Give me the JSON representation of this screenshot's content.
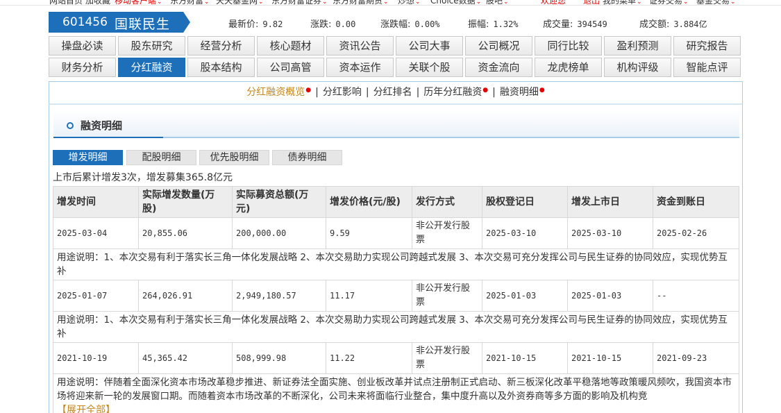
{
  "top_nav": [
    {
      "label": "网站首页",
      "red": false,
      "caret": false
    },
    {
      "label": "加收藏",
      "red": false,
      "caret": false
    },
    {
      "label": "移动客户端",
      "red": true,
      "caret": true
    },
    {
      "label": "东方财富",
      "red": false,
      "caret": true
    },
    {
      "label": "天天基金网",
      "red": false,
      "caret": true
    },
    {
      "label": "东方财富证券",
      "red": false,
      "caret": true
    },
    {
      "label": "东方财富期货",
      "red": false,
      "caret": true
    },
    {
      "label": "炒想",
      "red": false,
      "caret": true
    },
    {
      "label": "Choice数据",
      "red": false,
      "caret": true
    },
    {
      "label": "股吧",
      "red": false,
      "caret": true
    },
    {
      "label": "欢迎您",
      "red": true,
      "caret": false
    },
    {
      "label": "退出",
      "red": true,
      "caret": false
    },
    {
      "label": "我的菜单",
      "red": false,
      "caret": true
    },
    {
      "label": "证券交易",
      "red": false,
      "caret": true
    },
    {
      "label": "基金交易",
      "red": false,
      "caret": true
    }
  ],
  "stock": {
    "code": "601456",
    "name": "国联民生",
    "quotes": [
      {
        "label": "最新价:",
        "value": "9.82"
      },
      {
        "label": "涨跌:",
        "value": "0.00"
      },
      {
        "label": "涨跌幅:",
        "value": "0.00%"
      },
      {
        "label": "振幅:",
        "value": "1.32%"
      },
      {
        "label": "成交量:",
        "value": "394549"
      },
      {
        "label": "成交额:",
        "value": "3.884亿"
      }
    ]
  },
  "tabs": {
    "row1": [
      "操盘必读",
      "股东研究",
      "经营分析",
      "核心题材",
      "资讯公告",
      "公司大事",
      "公司概况",
      "同行比较",
      "盈利预测",
      "研究报告"
    ],
    "row2": [
      "财务分析",
      "分红融资",
      "股本结构",
      "公司高管",
      "资本运作",
      "关联个股",
      "资金流向",
      "龙虎榜单",
      "机构评级",
      "智能点评"
    ],
    "active": "分红融资"
  },
  "subnav": {
    "items": [
      {
        "label": "分红融资概览",
        "dot": true,
        "current": true
      },
      {
        "label": "分红影响",
        "dot": false,
        "current": false
      },
      {
        "label": "分红排名",
        "dot": false,
        "current": false
      },
      {
        "label": "历年分红融资",
        "dot": true,
        "current": false
      },
      {
        "label": "融资明细",
        "dot": true,
        "current": false
      }
    ],
    "dot_glyph": "●"
  },
  "section": {
    "title": "融资明细",
    "subtabs": [
      "增发明细",
      "配股明细",
      "优先股明细",
      "债券明细"
    ],
    "active_subtab": "增发明细",
    "summary": "上市后累计增发3次，增发募集365.8亿元",
    "expand_label": "【展开全部】"
  },
  "table": {
    "headers": [
      "增发时间",
      "实际增发数量(万股)",
      "实际募资总额(万元)",
      "增发价格(元/股)",
      "发行方式",
      "股权登记日",
      "增发上市日",
      "资金到账日"
    ],
    "rows": [
      {
        "cells": [
          "2025-03-04",
          "20,855.06",
          "200,000.00",
          "9.59",
          "非公开发行股票",
          "2025-03-10",
          "2025-03-10",
          "2025-02-26"
        ],
        "usage": "用途说明：1、本次交易有利于落实长三角一体化发展战略 2、本次交易助力实现公司跨越式发展 3、本次交易可充分发挥公司与民生证券的协同效应，实现优势互补"
      },
      {
        "cells": [
          "2025-01-07",
          "264,026.91",
          "2,949,180.57",
          "11.17",
          "非公开发行股票",
          "2025-01-03",
          "2025-01-03",
          "--"
        ],
        "usage": "用途说明：1、本次交易有利于落实长三角一体化发展战略 2、本次交易助力实现公司跨越式发展 3、本次交易可充分发挥公司与民生证券的协同效应，实现优势互补"
      },
      {
        "cells": [
          "2021-10-19",
          "45,365.42",
          "508,999.98",
          "11.22",
          "非公开发行股票",
          "2021-10-15",
          "2021-10-15",
          "2021-09-23"
        ],
        "usage": "用途说明：伴随着全面深化资本市场改革稳步推进、新证券法全面实施、创业板改革并试点注册制正式启动、新三板深化改革平稳落地等政策暖风频吹，我国资本市场将迎来新一轮的发展窗口期。而随着资本市场改革的不断深化，公司未来将面临行业整合，集中度升高以及外资券商等多方面的影响及机构竞"
      }
    ]
  }
}
